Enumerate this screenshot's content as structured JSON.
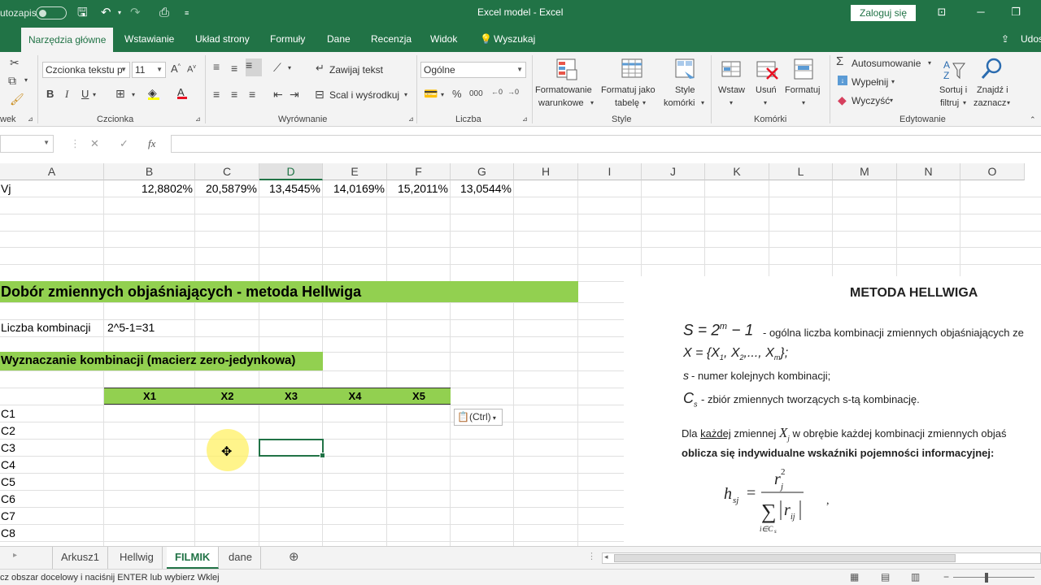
{
  "titlebar": {
    "autosave_label": "utozapis",
    "title": "Excel model  -  Excel",
    "signin": "Zaloguj się"
  },
  "ribbon_tabs": [
    "Narzędzia główne",
    "Wstawianie",
    "Układ strony",
    "Formuły",
    "Dane",
    "Recenzja",
    "Widok",
    "Wyszukaj",
    "Udos"
  ],
  "ribbon": {
    "font_name": "Czcionka tekstu p",
    "font_size": "11",
    "wrap_text": "Zawijaj tekst",
    "merge": "Scal i wyśrodkuj",
    "number_format": "Ogólne",
    "cond_format_1": "Formatowanie",
    "cond_format_2": "warunkowe",
    "table_format_1": "Formatuj jako",
    "table_format_2": "tabelę",
    "cell_styles_1": "Style",
    "cell_styles_2": "komórki",
    "insert": "Wstaw",
    "delete": "Usuń",
    "format": "Formatuj",
    "autosum": "Autosumowanie",
    "fill": "Wypełnij",
    "clear": "Wyczyść",
    "sort_1": "Sortuj i",
    "sort_2": "filtruj",
    "find_1": "Znajdź i",
    "find_2": "zaznacz",
    "groups": {
      "clipboard": "wek",
      "font": "Czcionka",
      "alignment": "Wyrównanie",
      "number": "Liczba",
      "styles": "Style",
      "cells": "Komórki",
      "editing": "Edytowanie"
    }
  },
  "formula_bar": {
    "fx": "fx",
    "cancel": "✕",
    "enter": "✓"
  },
  "columns": [
    "A",
    "B",
    "C",
    "D",
    "E",
    "F",
    "G",
    "H",
    "I",
    "J",
    "K",
    "L",
    "M",
    "N",
    "O"
  ],
  "sheet": {
    "vj_label": "Vj",
    "vj_values": [
      "12,8802%",
      "20,5879%",
      "13,4545%",
      "14,0169%",
      "15,2011%",
      "13,0544%"
    ],
    "section_title": "Dobór zmiennych objaśniających - metoda Hellwiga",
    "combos_label": "Liczba kombinacji",
    "combos_value": "2^5-1=31",
    "matrix_title": "Wyznaczanie kombinacji (macierz zero-jedynkowa)",
    "var_headers": [
      "X1",
      "X2",
      "X3",
      "X4",
      "X5"
    ],
    "combo_rows": [
      "C1",
      "C2",
      "C3",
      "C4",
      "C5",
      "C6",
      "C7",
      "C8"
    ],
    "paste_options": "(Ctrl)"
  },
  "hellwig_panel": {
    "title": "METODA HELLWIGA",
    "line1": " - ogólna liczba kombinacji zmiennych objaśniających ze",
    "line2_text": "- numer kolejnych kombinacji;",
    "line3_text": "- zbiór zmiennych tworzących s-tą kombinację.",
    "line4_a": "Dla ",
    "line4_b": "każdej",
    "line4_c": " zmiennej ",
    "line4_d": " w obrębie każdej kombinacji zmiennych objaś",
    "line5": "oblicza się indywidualne wskaźniki pojemności informacyjnej:"
  },
  "sheet_tabs": [
    "Arkusz1",
    "Hellwig",
    "FILMIK",
    "dane"
  ],
  "status": "cz obszar docelowy i naciśnij ENTER lub wybierz Wklej"
}
